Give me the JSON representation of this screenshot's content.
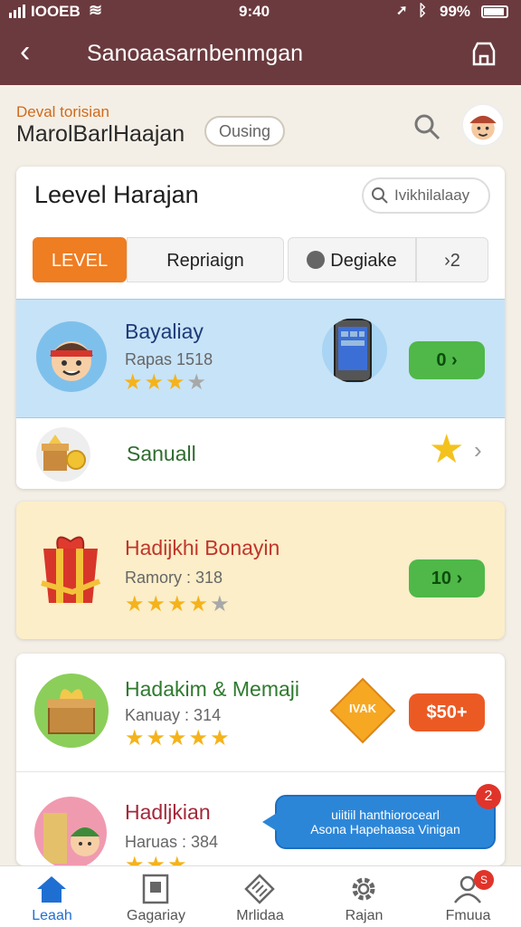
{
  "status": {
    "carrier": "IOOEB",
    "time": "9:40",
    "battery": "99%"
  },
  "titlebar": {
    "title": "Sanoaasarnbenmgan",
    "back_icon": "chevron-left-icon",
    "store_icon": "store-icon"
  },
  "header": {
    "small": "Deval torisian",
    "big": "MarolBarlHaajan",
    "pill": "Ousing",
    "search_icon": "search-icon",
    "avatar_icon": "avatar-icon"
  },
  "level_card": {
    "title": "Leevel Harajan",
    "search_placeholder": "Ivikhilalaay",
    "tabs": [
      {
        "label": "LEVEL"
      },
      {
        "label": "Repriaign"
      },
      {
        "label": "Degiake"
      },
      {
        "label": "›2"
      }
    ],
    "highlight": {
      "name": "Bayaliay",
      "sub": "Rapas 1518",
      "rating": 3,
      "rating_max": 4,
      "badge": "0 ›"
    },
    "row": {
      "label": "Sanuall"
    }
  },
  "card2": {
    "name": "Hadijkhi Bonayin",
    "sub": "Ramory : 318",
    "rating": 4,
    "rating_max": 5,
    "badge": "10 ›"
  },
  "card3": {
    "item1": {
      "name": "Hadakim & Memaji",
      "sub": "Kanuay : 314",
      "rating": 5,
      "rating_max": 5,
      "tag": "IVAK",
      "badge": "$50+"
    },
    "item2": {
      "name": "Hadljkian",
      "sub": "Haruas : 384",
      "bubble_line1": "uiitiil hanthiorocearl",
      "bubble_line2": "Asona Hapehaasa Vinigan",
      "bubble_count": "2"
    }
  },
  "tabbar": [
    {
      "label": "Leaah",
      "icon": "home-icon"
    },
    {
      "label": "Gagariay",
      "icon": "profile-card-icon"
    },
    {
      "label": "Mrlidaa",
      "icon": "diamond-icon"
    },
    {
      "label": "Rajan",
      "icon": "gear-icon"
    },
    {
      "label": "Fmuua",
      "icon": "user-icon",
      "badge": "S"
    }
  ],
  "colors": {
    "brand": "#6b3a3e",
    "accent": "#ef7d22",
    "highlight_bg": "#c7e3f7",
    "green": "#4fb848",
    "link": "#1f6fd3"
  }
}
